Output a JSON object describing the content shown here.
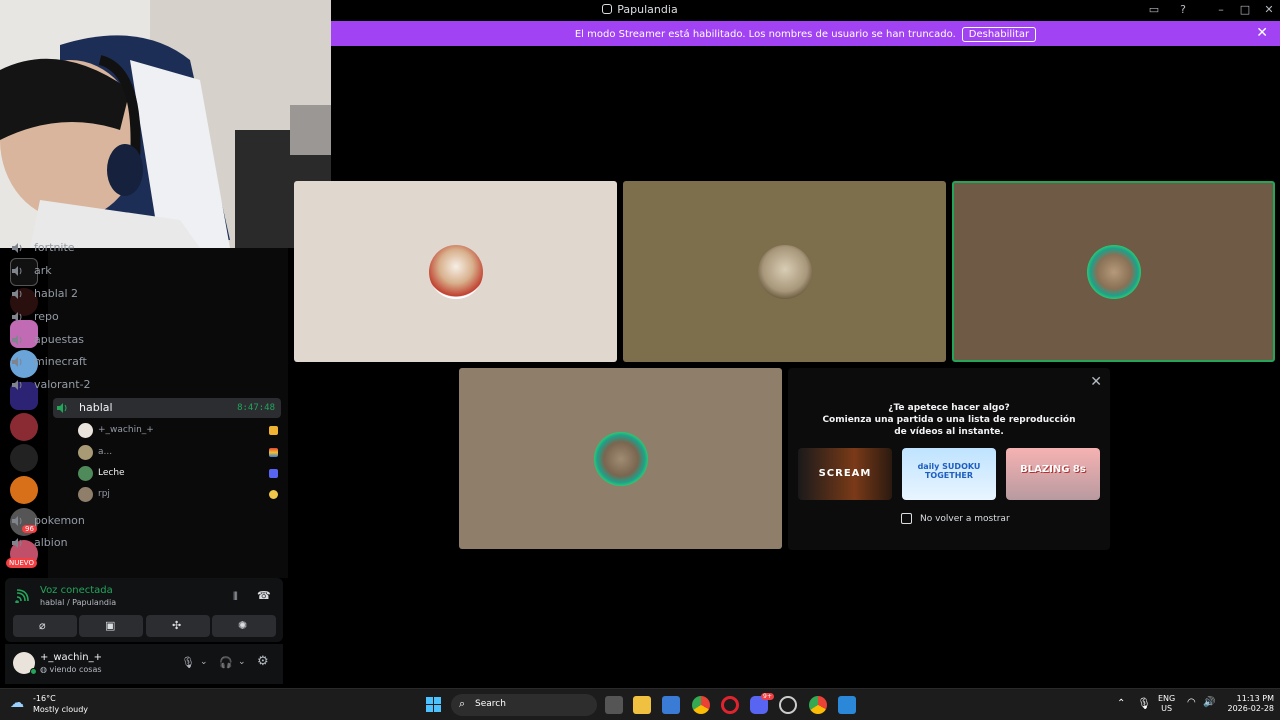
{
  "window": {
    "title": "Papulandia"
  },
  "banner": {
    "message": "El modo Streamer está habilitado. Los nombres de usuario se han truncado.",
    "button": "Deshabilitar"
  },
  "channels": [
    {
      "name": "fortnite"
    },
    {
      "name": "ark"
    },
    {
      "name": "hablal 2"
    },
    {
      "name": "repo"
    },
    {
      "name": "apuestas"
    },
    {
      "name": "minecraft"
    },
    {
      "name": "valorant-2"
    },
    {
      "name": "hablal",
      "timer": "8:47:48"
    },
    {
      "name": "pokemon"
    },
    {
      "name": "albion"
    }
  ],
  "voice_users": [
    {
      "name": "+_wachin_+",
      "color": "#b5bac1"
    },
    {
      "name": "a...",
      "color": "#b5bac1"
    },
    {
      "name": "Leche",
      "color": "#f2f3f5"
    },
    {
      "name": "rpj",
      "color": "#b5bac1"
    }
  ],
  "servers": {
    "badge_count": "96",
    "new_label": "NUEVO"
  },
  "voice": {
    "status": "Voz conectada",
    "location": "hablal / Papulandia"
  },
  "user": {
    "name": "+_wachin_+",
    "activity": "viendo cosas"
  },
  "popup": {
    "line1": "¿Te apetece hacer algo?",
    "line2": "Comienza una partida o una lista de reproducción de vídeos al instante.",
    "checkbox": "No volver a mostrar",
    "activities": [
      {
        "name": "SCREAM"
      },
      {
        "name": "daily SUDOKU TOGETHER"
      },
      {
        "name": "BLAZING 8s"
      }
    ]
  },
  "taskbar": {
    "weather_temp": "-16°C",
    "weather_desc": "Mostly cloudy",
    "search": "Search",
    "lang_top": "ENG",
    "lang_bottom": "US",
    "time": "11:13 PM",
    "date": "2026-02-28",
    "discord_badge": "9+"
  },
  "colors": {
    "accent": "#a143f2",
    "connected": "#23a55a",
    "tile1": "#e0d8cf",
    "tile2": "#7d6f4c",
    "tile3": "#6f5a45",
    "tile4": "#8f7f6a"
  }
}
